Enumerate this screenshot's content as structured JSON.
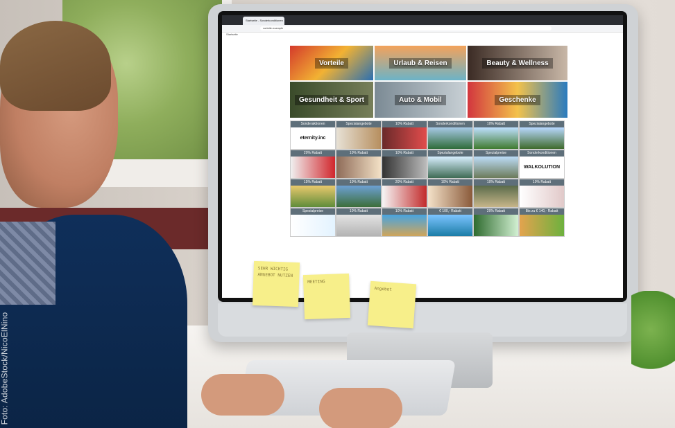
{
  "browser": {
    "tab_title": "Startseite - Sonderkonditionen",
    "url": "vorteile.example",
    "bookmark": "Startseite"
  },
  "categories": [
    {
      "label": "Vorteile"
    },
    {
      "label": "Urlaub & Reisen"
    },
    {
      "label": "Beauty & Wellness"
    },
    {
      "label": "Gesundheit & Sport"
    },
    {
      "label": "Auto & Mobil"
    },
    {
      "label": "Geschenke"
    }
  ],
  "offers": [
    {
      "caption": "Sonderaktionen",
      "logo": "eternity.inc"
    },
    {
      "caption": "Spezialangebote"
    },
    {
      "caption": "10% Rabatt"
    },
    {
      "caption": "Sonderkonditionen"
    },
    {
      "caption": "10% Rabatt"
    },
    {
      "caption": "Spezialangebote"
    },
    {
      "caption": "20% Rabatt"
    },
    {
      "caption": "10% Rabatt"
    },
    {
      "caption": "10% Rabatt"
    },
    {
      "caption": "Spezialangebote"
    },
    {
      "caption": "Spezialpreise"
    },
    {
      "caption": "Sonderkonditionen",
      "logo": "WALKOLUTION"
    },
    {
      "caption": "15% Rabatt"
    },
    {
      "caption": "10% Rabatt"
    },
    {
      "caption": "20% Rabatt"
    },
    {
      "caption": "10% Rabatt"
    },
    {
      "caption": "10% Rabatt"
    },
    {
      "caption": "10% Rabatt"
    },
    {
      "caption": "Spezialpreise"
    },
    {
      "caption": "10% Rabatt"
    },
    {
      "caption": "10% Rabatt"
    },
    {
      "caption": "€ 100,- Rabatt"
    },
    {
      "caption": "20% Rabatt"
    },
    {
      "caption": "Bis zu € 140,- Rabatt"
    }
  ],
  "sticky_notes": [
    "SEHR WICHTIG ANGEBOT NUTZEN",
    "MEETING",
    "Angebot"
  ],
  "credit": "Foto: AdobeStock/NicoElNino",
  "colors": {
    "caption_bg": "#5e6f7a",
    "note": "#f7ef8a"
  }
}
